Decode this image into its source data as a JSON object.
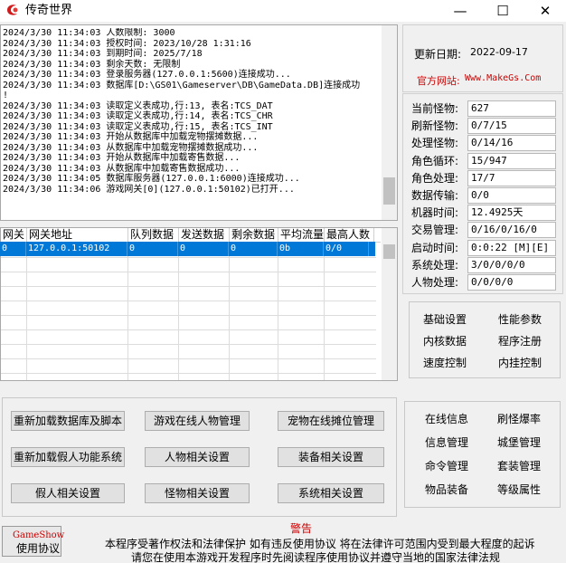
{
  "window": {
    "title": "传奇世界",
    "minimize_glyph": "—",
    "maximize_glyph": "☐",
    "close_glyph": "✕",
    "app_icon": "app-logo-icon"
  },
  "log_lines": [
    "2024/3/30 11:34:03 人数限制: 3000",
    "2024/3/30 11:34:03 授权时间: 2023/10/28 1:31:16",
    "2024/3/30 11:34:03 到期时间: 2025/7/18",
    "2024/3/30 11:34:03 剩余天数: 无限制",
    "2024/3/30 11:34:03 登录服务器(127.0.0.1:5600)连接成功...",
    "2024/3/30 11:34:03 数据库[D:\\GS01\\Gameserver\\DB\\GameData.DB]连接成功",
    "!",
    "2024/3/30 11:34:03 读取定义表成功,行:13, 表名:TCS_DAT",
    "2024/3/30 11:34:03 读取定义表成功,行:14, 表名:TCS_CHR",
    "2024/3/30 11:34:03 读取定义表成功,行:15, 表名:TCS_INT",
    "2024/3/30 11:34:03 开始从数据库中加载宠物摆摊数据...",
    "2024/3/30 11:34:03 从数据库中加载宠物摆摊数据成功...",
    "2024/3/30 11:34:03 开始从数据库中加载寄售数据...",
    "2024/3/30 11:34:03 从数据库中加载寄售数据成功...",
    "2024/3/30 11:34:05 数据库服务器(127.0.0.1:6000)连接成功...",
    "2024/3/30 11:34:06 游戏网关[0](127.0.0.1:50102)已打开..."
  ],
  "gateway_table": {
    "columns": [
      "网关",
      "网关地址",
      "队列数据",
      "发送数据",
      "剩余数据",
      "平均流量",
      "最高人数"
    ],
    "rows": [
      [
        "0",
        "127.0.0.1:50102",
        "0",
        "0",
        "0",
        "0b",
        "0/0"
      ]
    ]
  },
  "info": {
    "update_label": "更新日期:",
    "update_value": "2022-09-17",
    "site_label": "官方网站:",
    "site_value": "Www.MakeGs.Com"
  },
  "stats": [
    {
      "label": "当前怪物:",
      "value": "627"
    },
    {
      "label": "刷新怪物:",
      "value": "0/7/15"
    },
    {
      "label": "处理怪物:",
      "value": "0/14/16"
    },
    {
      "label": "角色循环:",
      "value": "15/947"
    },
    {
      "label": "角色处理:",
      "value": "17/7"
    },
    {
      "label": "数据传输:",
      "value": "0/0"
    },
    {
      "label": "机器时间:",
      "value": "12.4925天"
    },
    {
      "label": "交易管理:",
      "value": "0/16/0/16/0"
    },
    {
      "label": "启动时间:",
      "value": "0:0:22 [M][E]"
    },
    {
      "label": "系统处理:",
      "value": "3/0/0/0/0"
    },
    {
      "label": "人物处理:",
      "value": "0/0/0/0"
    }
  ],
  "right_buttons": [
    "基础设置",
    "性能参数",
    "内核数据",
    "程序注册",
    "速度控制",
    "内挂控制"
  ],
  "bottom_left_buttons": [
    "重新加载数据库及脚本",
    "游戏在线人物管理",
    "宠物在线摊位管理",
    "重新加载假人功能系统",
    "人物相关设置",
    "装备相关设置",
    "假人相关设置",
    "怪物相关设置",
    "系统相关设置"
  ],
  "bottom_right_buttons": [
    "在线信息",
    "刷怪爆率",
    "信息管理",
    "城堡管理",
    "命令管理",
    "套装管理",
    "物品装备",
    "等级属性"
  ],
  "footer": {
    "warning_title": "警告",
    "line1": "本程序受著作权法和法律保护 如有违反使用协议 将在法律许可范围内受到最大程度的起诉",
    "line2": "请您在使用本游戏开发程序时先阅读程序使用协议并遵守当地的国家法律法规",
    "gameshow_label": "GameShow",
    "gameshow_button": "使用协议"
  },
  "colors": {
    "selection": "#0078d7",
    "warning": "#cc0000"
  }
}
